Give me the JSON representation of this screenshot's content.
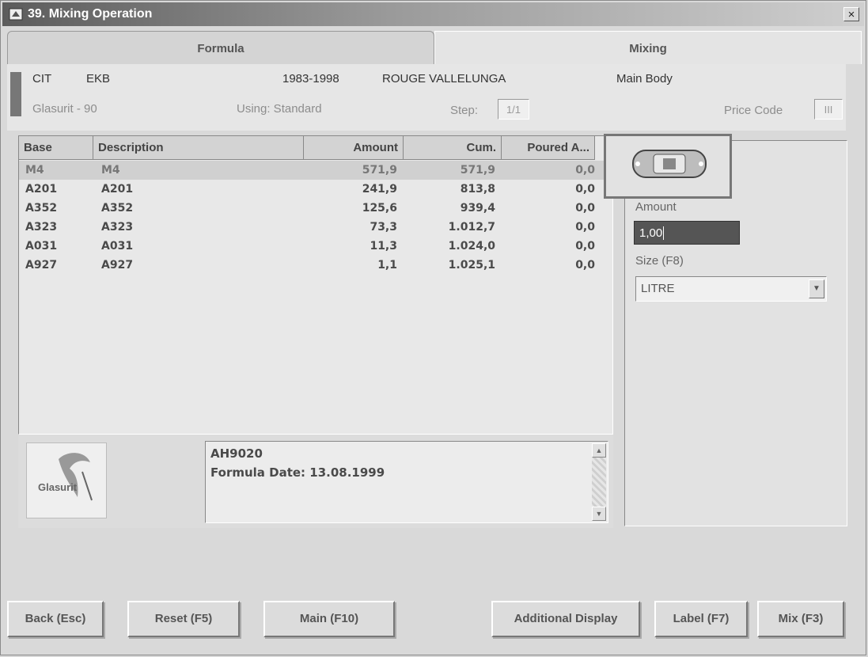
{
  "window": {
    "title": "39. Mixing Operation",
    "close_glyph": "×"
  },
  "tabs": [
    {
      "label": "Formula"
    },
    {
      "label": "Mixing"
    }
  ],
  "header": {
    "make": "CIT",
    "code": "EKB",
    "years": "1983-1998",
    "color_name": "ROUGE VALLELUNGA",
    "area": "Main Body",
    "product_line": "Glasurit - 90",
    "using": "Using: Standard",
    "step_label": "Step:",
    "step_value": "1/1",
    "price_code_label": "Price Code",
    "price_code_value": "III",
    "swatch_color": "#777777"
  },
  "table": {
    "columns": [
      "Base",
      "Description",
      "Amount",
      "Cum.",
      "Poured A..."
    ],
    "rows": [
      [
        "M4",
        "M4",
        "571,9",
        "571,9",
        "0,0"
      ],
      [
        "A201",
        "A201",
        "241,9",
        "813,8",
        "0,0"
      ],
      [
        "A352",
        "A352",
        "125,6",
        "939,4",
        "0,0"
      ],
      [
        "A323",
        "A323",
        "73,3",
        "1.012,7",
        "0,0"
      ],
      [
        "A031",
        "A031",
        "11,3",
        "1.024,0",
        "0,0"
      ],
      [
        "A927",
        "A927",
        "1,1",
        "1.025,1",
        "0,0"
      ]
    ]
  },
  "info": {
    "logo_text": "Glasurit",
    "note_code": "AH9020",
    "formula_date": "Formula Date:  13.08.1999"
  },
  "side": {
    "amount_label": "Amount",
    "amount_value": "1,00",
    "size_label": "Size (F8)",
    "size_value": "LITRE",
    "car_icon": "car-top-view-icon"
  },
  "buttons": {
    "back": "Back (Esc)",
    "reset": "Reset (F5)",
    "main": "Main (F10)",
    "additional": "Additional Display",
    "label": "Label (F7)",
    "mix": "Mix (F3)"
  }
}
